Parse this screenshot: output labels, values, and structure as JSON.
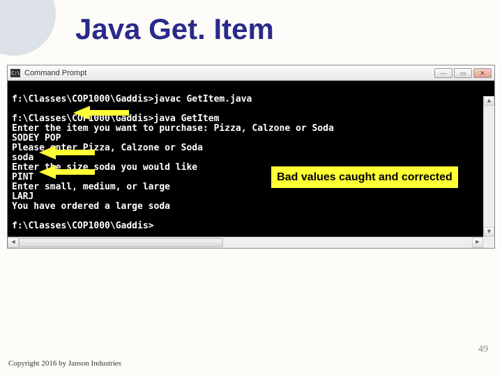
{
  "slide": {
    "title": "Java Get. Item",
    "page_number": "49",
    "copyright": "Copyright 2016 by Janson Industries"
  },
  "cmd": {
    "icon_text": "C:\\",
    "title": "Command Prompt",
    "win_buttons": {
      "min": "—",
      "max": "▭",
      "close": "✕"
    },
    "lines": {
      "l0": "",
      "l1": "f:\\Classes\\COP1000\\Gaddis>javac GetItem.java",
      "l2": "",
      "l3": "f:\\Classes\\COP1000\\Gaddis>java GetItem",
      "l4": "Enter the item you want to purchase: Pizza, Calzone or Soda",
      "l5": "SODEY POP",
      "l6": "Please enter Pizza, Calzone or Soda",
      "l7": "soda",
      "l8": "Enter the size soda you would like",
      "l9": "PINT",
      "l10": "Enter small, medium, or large",
      "l11": "LARJ",
      "l12": "You have ordered a large soda",
      "l13": "",
      "l14": "f:\\Classes\\COP1000\\Gaddis>"
    }
  },
  "callout": {
    "text": "Bad values caught and corrected"
  }
}
